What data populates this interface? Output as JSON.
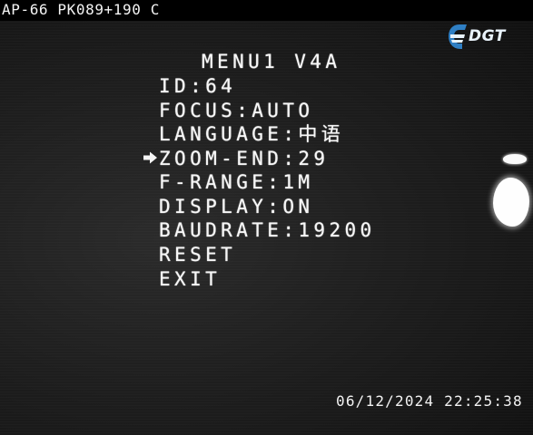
{
  "camera": {
    "label": "AP-66 PK089+190 C"
  },
  "logo": {
    "text": "DGT",
    "icon": "dgt-logo-icon",
    "color": "#2f7fc4"
  },
  "menu": {
    "title": "MENU1 V4A",
    "cursor_icon": "arrow-right-icon",
    "selected_index": 3,
    "items": [
      {
        "label": "ID:64"
      },
      {
        "label": "FOCUS:AUTO"
      },
      {
        "label": "LANGUAGE:中语"
      },
      {
        "label": "ZOOM-END:29"
      },
      {
        "label": "F-RANGE:1M"
      },
      {
        "label": "DISPLAY:ON"
      },
      {
        "label": "BAUDRATE:19200"
      },
      {
        "label": "RESET"
      },
      {
        "label": "EXIT"
      }
    ]
  },
  "timestamp": "06/12/2024 22:25:38"
}
